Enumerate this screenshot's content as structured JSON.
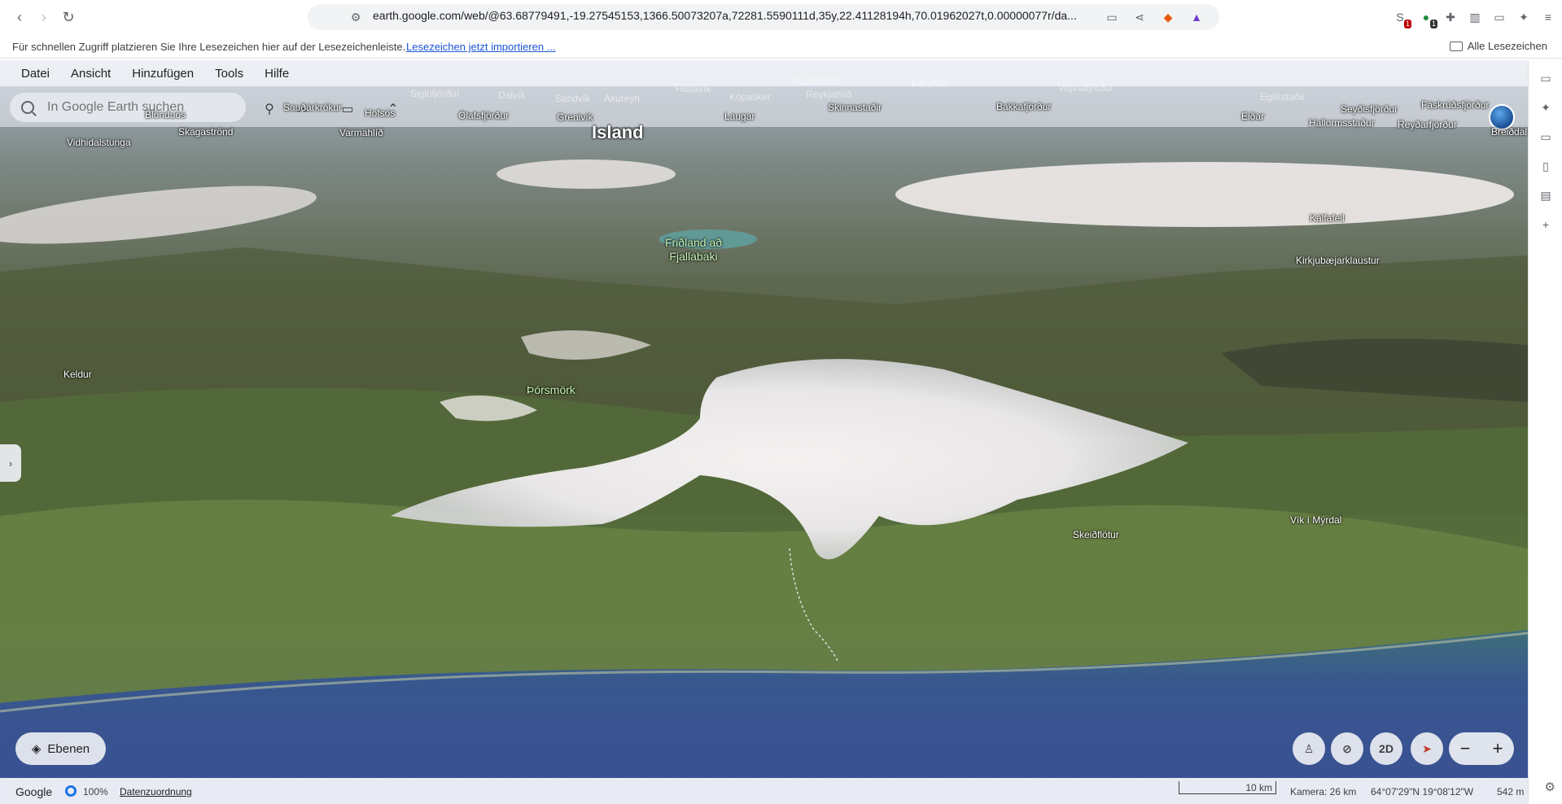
{
  "browser": {
    "url": "earth.google.com/web/@63.68779491,-19.27545153,1366.50073207a,72281.5590111d,35y,22.41128194h,70.01962027t,0.00000077r/da...",
    "extension_badges": [
      "1",
      "1"
    ]
  },
  "bookmarks": {
    "hint": "Für schnellen Zugriff platzieren Sie Ihre Lesezeichen hier auf der Lesezeichenleiste.",
    "import_link": "Lesezeichen jetzt importieren ...",
    "all_label": "Alle Lesezeichen"
  },
  "menu": [
    "Datei",
    "Ansicht",
    "Hinzufügen",
    "Tools",
    "Hilfe"
  ],
  "search": {
    "placeholder": "In Google Earth suchen"
  },
  "labels": {
    "bolungarvik": "Siglufjörður",
    "dalvik": "Dalvík",
    "sandvik": "Sandvík",
    "akureyri": "Akureyri",
    "husavik": "Húsavík",
    "kopasker": "Kópasker",
    "raufarhofn": "Raufarhöfn",
    "reykjahlid": "Reykjahlíð",
    "thorshofn": "Þórshöfn",
    "vopnafjordur": "Vopnafjörður",
    "egilsstadir": "Egilsstaðir",
    "fjaskrudsfjordur": "Fáskrúðsfjörður",
    "blonduos": "Blönduós",
    "saudarkrokur": "Sauðárkrókur",
    "hofsos": "Hofsós",
    "olafsfjordur": "Ólafsfjörður",
    "grenivik": "Grenivík",
    "laugar": "Laugar",
    "skinnastadir": "Skinnastaðir",
    "bakkafjordur": "Bakkafjörður",
    "eidar": "Eiðar",
    "seydisfjordur": "Seyðisfjörður",
    "hallormsstadur": "Hallormsstaður",
    "reydarfjordur": "Reyðarfjörður",
    "breiddalsvik": "Breiðdal",
    "skagastrond": "Skagaströnd",
    "varmahlid": "Varmahlíð",
    "vidhidalstunga": "Vidhidalstunga",
    "island": "Island",
    "kalfafell": "Kálfafell",
    "kirkjubaejarklaustur": "Kirkjubæjarklaustur",
    "fridland": "Friðland að Fjallabaki",
    "keldur": "Keldur",
    "thorsmork": "Þórsmörk",
    "vik": "Vík í Mýrdal",
    "skeidflotur": "Skeiðflötur"
  },
  "controls": {
    "layers": "Ebenen",
    "twod": "2D",
    "zoom_out": "−",
    "zoom_in": "+"
  },
  "status": {
    "google": "Google",
    "zoom": "100%",
    "attribution": "Datenzuordnung",
    "scale": "10 km",
    "camera": "Kamera: 26 km",
    "coords": "64°07'29\"N 19°08'12\"W",
    "elevation": "542 m"
  }
}
